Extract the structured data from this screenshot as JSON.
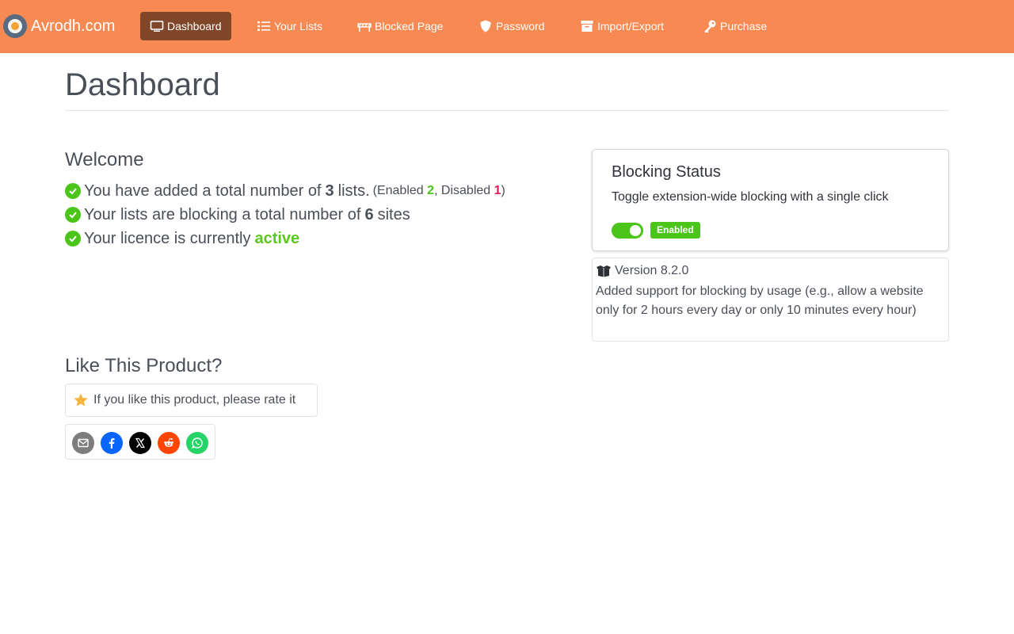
{
  "brand": {
    "name": "Avrodh.com"
  },
  "nav": [
    {
      "label": "Dashboard",
      "icon": "monitor-icon",
      "active": true
    },
    {
      "label": "Your Lists",
      "icon": "list-icon"
    },
    {
      "label": "Blocked Page",
      "icon": "barrier-icon"
    },
    {
      "label": "Password",
      "icon": "shield-icon"
    },
    {
      "label": "Import/Export",
      "icon": "archive-icon"
    },
    {
      "label": "Purchase",
      "icon": "key-icon"
    }
  ],
  "page": {
    "title": "Dashboard"
  },
  "welcome": {
    "heading": "Welcome",
    "line1_prefix": "You have added a total number of",
    "lists_count": "3",
    "line1_suffix": "lists.",
    "enabled_label": "(Enabled",
    "enabled_count": "2",
    "disabled_label": ", Disabled",
    "disabled_count": "1",
    "close_paren": ")",
    "line2_prefix": "Your lists are blocking a total number of",
    "sites_count": "6",
    "line2_suffix": "sites",
    "line3_prefix": "Your licence is currently",
    "licence_status": "active"
  },
  "blocking": {
    "title": "Blocking Status",
    "description": "Toggle extension-wide blocking with a single click",
    "enabled": true,
    "badge": "Enabled"
  },
  "version": {
    "label": "Version 8.2.0",
    "description": "Added support for blocking by usage (e.g., allow a website only for 2 hours every day or only 10 minutes every hour)"
  },
  "like": {
    "heading": "Like This Product?",
    "rate_text": "If you like this product, please rate it"
  },
  "share": [
    {
      "icon": "email-icon",
      "color": "#7d7d7d"
    },
    {
      "icon": "facebook-icon",
      "color": "#0866ff"
    },
    {
      "icon": "x-icon",
      "color": "#000000"
    },
    {
      "icon": "reddit-icon",
      "color": "#ff4500"
    },
    {
      "icon": "whatsapp-icon",
      "color": "#25d366"
    }
  ],
  "colors": {
    "navbar": "#f78a53",
    "nav_active": "#80462a",
    "success": "#4cc51b",
    "danger": "#e01d56"
  }
}
